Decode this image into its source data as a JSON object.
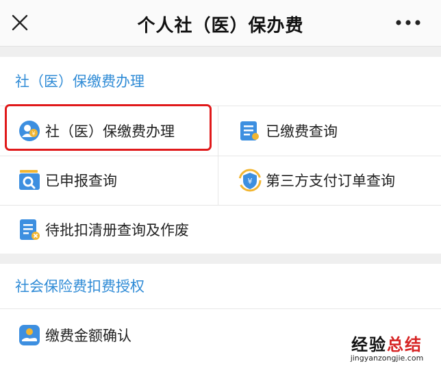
{
  "header": {
    "title": "个人社（医）保办费",
    "close_icon": "close-icon",
    "more_icon": "more-icon"
  },
  "sections": [
    {
      "title": "社（医）保缴费办理",
      "items": [
        {
          "label": "社（医）保缴费办理",
          "icon": "user-payment-icon",
          "highlighted": true
        },
        {
          "label": "已缴费查询",
          "icon": "document-search-icon"
        },
        {
          "label": "已申报查询",
          "icon": "folder-search-icon"
        },
        {
          "label": "第三方支付订单查询",
          "icon": "yen-shield-icon"
        },
        {
          "label": "待批扣清册查询及作废",
          "icon": "document-cancel-icon"
        }
      ]
    },
    {
      "title": "社会保险费扣费授权",
      "items": [
        {
          "label": "缴费金额确认",
          "icon": "hand-payment-icon"
        }
      ]
    }
  ],
  "watermark": {
    "main_black": "经验",
    "main_red": "总结",
    "sub": "jingyanzongjie.com"
  },
  "colors": {
    "section_title": "#2f8bd6",
    "highlight_border": "#e0191a",
    "background": "#efefef"
  }
}
